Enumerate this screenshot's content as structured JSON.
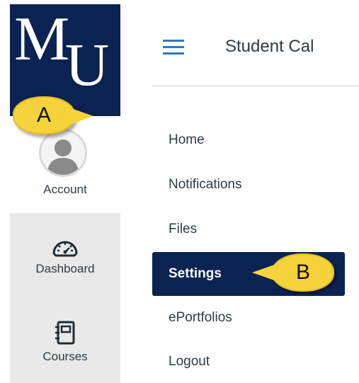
{
  "logo": {
    "letter_m": "M",
    "letter_u": "U",
    "color": "#0b2353"
  },
  "global_nav": {
    "account_label": "Account",
    "dashboard_label": "Dashboard",
    "courses_label": "Courses",
    "icons": [
      "user-avatar-icon",
      "dashboard-gauge-icon",
      "notebook-icon"
    ]
  },
  "header": {
    "title": "Student Cal",
    "menu_icon": "hamburger-icon"
  },
  "course_nav": {
    "items": [
      {
        "label": "Home"
      },
      {
        "label": "Notifications"
      },
      {
        "label": "Files"
      },
      {
        "label": "Settings",
        "active": true
      },
      {
        "label": "ePortfolios"
      },
      {
        "label": "Logout"
      }
    ]
  },
  "callouts": {
    "a": "A",
    "b": "B",
    "color": "#f6d23b"
  },
  "colors": {
    "brand_navy": "#0b2353",
    "menu_blue": "#2b7abc",
    "text": "#2d3b45"
  }
}
